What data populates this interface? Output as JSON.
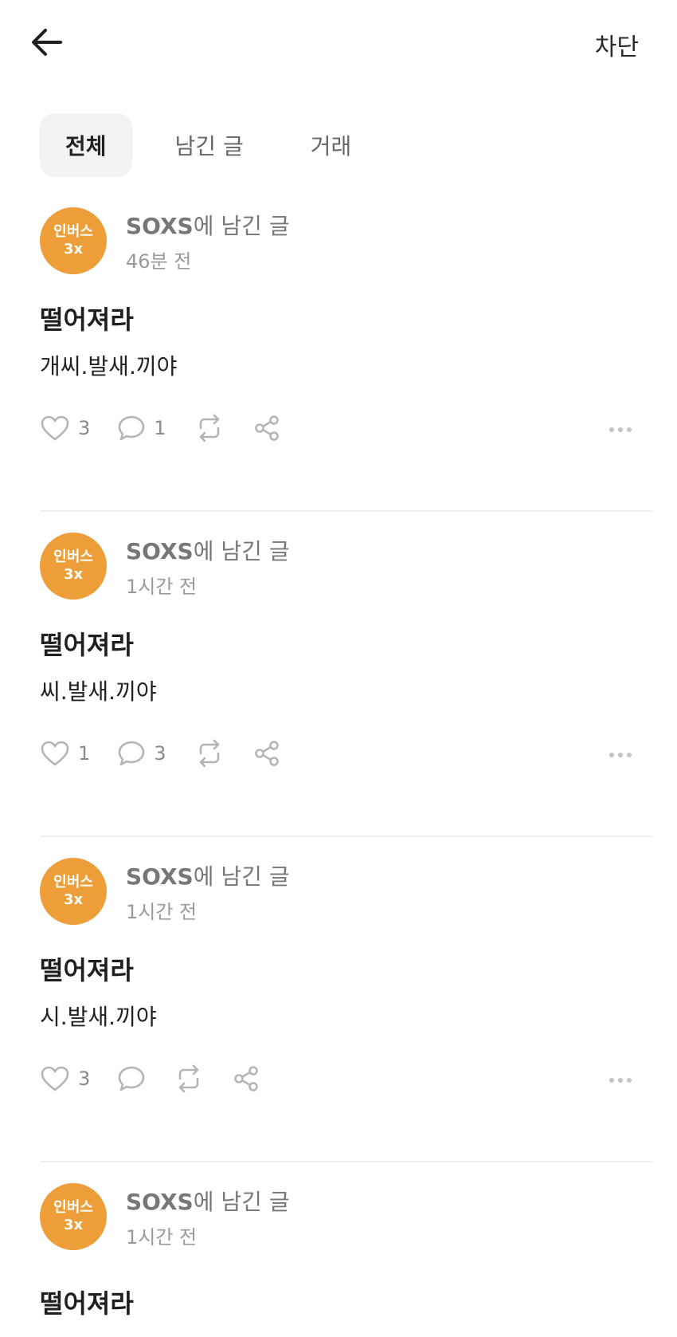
{
  "header": {
    "back_icon": "arrow-left-icon",
    "block_label": "차단"
  },
  "tabs": [
    {
      "label": "전체",
      "active": true
    },
    {
      "label": "남긴 글",
      "active": false
    },
    {
      "label": "거래",
      "active": false
    }
  ],
  "posts": [
    {
      "avatar": {
        "line1": "인버스",
        "line2": "3x",
        "color": "#ee9e38"
      },
      "author_ticker": "SOXS",
      "author_suffix": "에 남긴 글",
      "time": "46분 전",
      "title": "떨어져라",
      "body": "개씨.발새.끼야",
      "likes": "3",
      "comments": "1"
    },
    {
      "avatar": {
        "line1": "인버스",
        "line2": "3x",
        "color": "#ee9e38"
      },
      "author_ticker": "SOXS",
      "author_suffix": "에 남긴 글",
      "time": "1시간 전",
      "title": "떨어져라",
      "body": "씨.발새.끼야",
      "likes": "1",
      "comments": "3"
    },
    {
      "avatar": {
        "line1": "인버스",
        "line2": "3x",
        "color": "#ee9e38"
      },
      "author_ticker": "SOXS",
      "author_suffix": "에 남긴 글",
      "time": "1시간 전",
      "title": "떨어져라",
      "body": "시.발새.끼야",
      "likes": "3",
      "comments": ""
    },
    {
      "avatar": {
        "line1": "인버스",
        "line2": "3x",
        "color": "#ee9e38"
      },
      "author_ticker": "SOXS",
      "author_suffix": "에 남긴 글",
      "time": "1시간 전",
      "title": "떨어져라",
      "body": "",
      "likes": "",
      "comments": ""
    }
  ],
  "icons": {
    "like": "heart-icon",
    "comment": "comment-icon",
    "repost": "repost-icon",
    "share": "share-icon",
    "more": "more-icon"
  },
  "colors": {
    "accent_avatar": "#ee9e38",
    "muted_text": "#8a8a8a",
    "divider": "#efefef"
  }
}
